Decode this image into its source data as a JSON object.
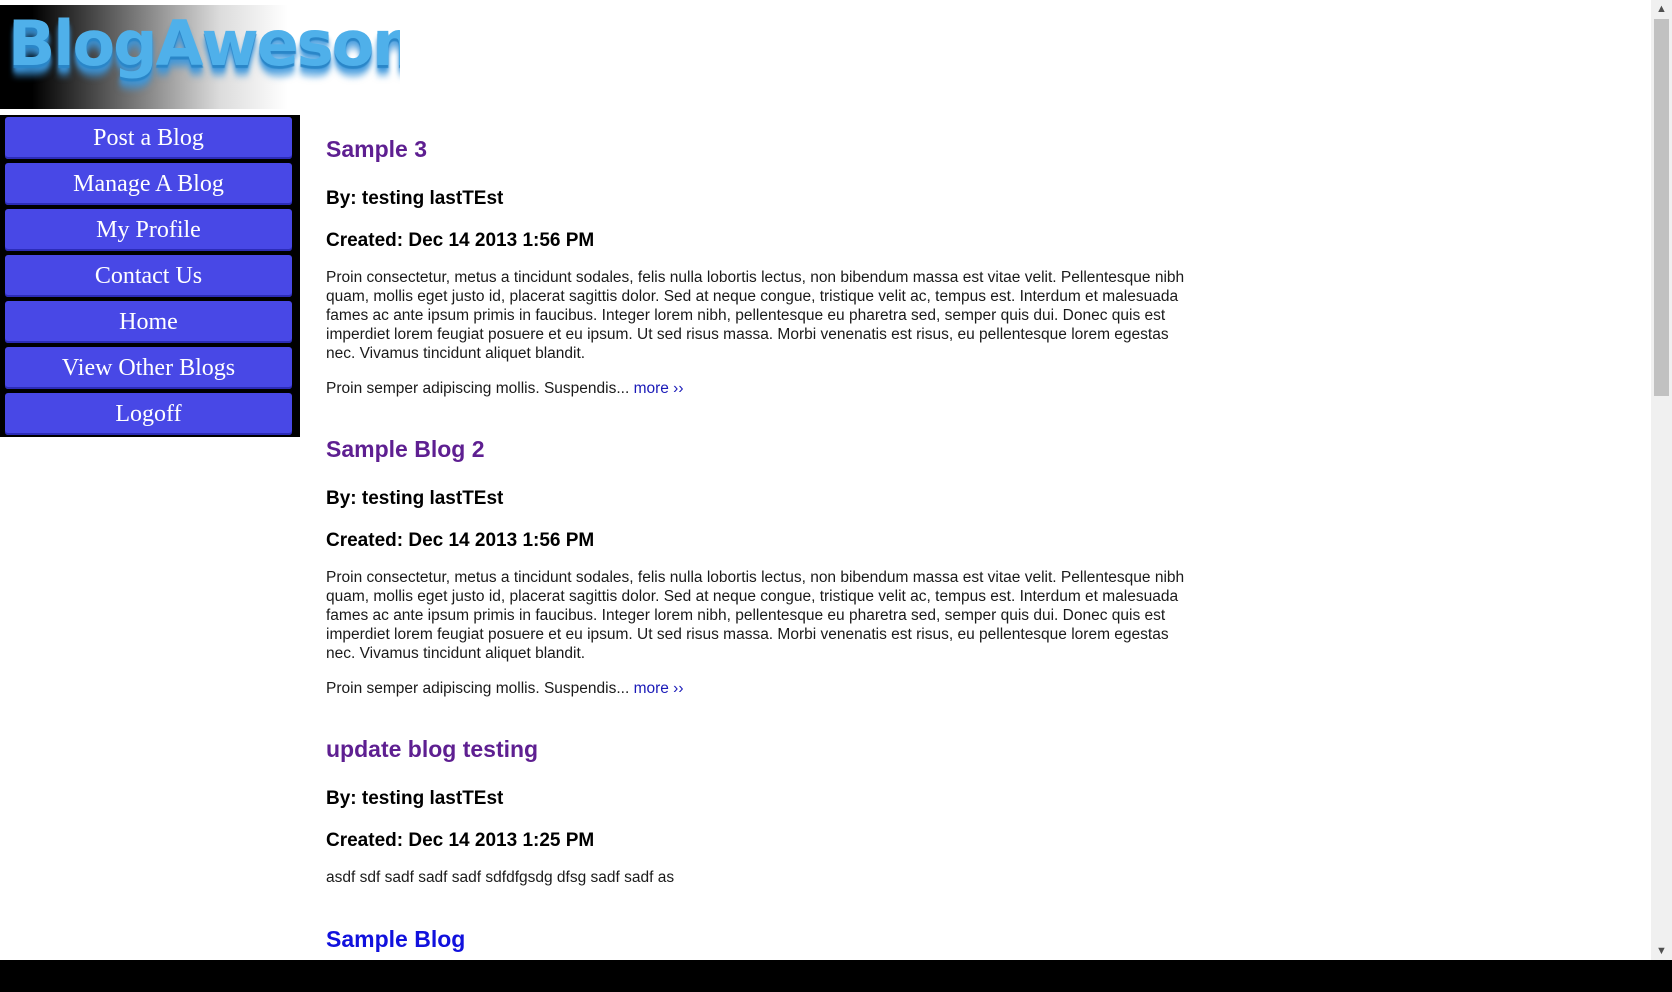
{
  "logo": {
    "text": "BlogAwesome!"
  },
  "nav": {
    "items": [
      {
        "label": "Post a Blog"
      },
      {
        "label": "Manage A Blog"
      },
      {
        "label": "My Profile"
      },
      {
        "label": "Contact Us"
      },
      {
        "label": "Home"
      },
      {
        "label": "View Other Blogs"
      },
      {
        "label": "Logoff"
      }
    ]
  },
  "posts": [
    {
      "title": "Sample 3",
      "author": "By: testing lastTEst",
      "created": "Created: Dec 14 2013 1:56 PM",
      "body": "Proin consectetur, metus a tincidunt sodales, felis nulla lobortis lectus, non bibendum massa est vitae velit. Pellentesque nibh quam, mollis eget justo id, placerat sagittis dolor. Sed at neque congue, tristique velit ac, tempus est. Interdum et malesuada fames ac ante ipsum primis in faucibus. Integer lorem nibh, pellentesque eu pharetra sed, semper quis dui. Donec quis est imperdiet lorem feugiat posuere et eu ipsum. Ut sed risus massa. Morbi venenatis est risus, eu pellentesque lorem egestas nec. Vivamus tincidunt aliquet blandit.",
      "excerpt": "Proin semper adipiscing mollis. Suspendis... ",
      "more_label": "more ››"
    },
    {
      "title": "Sample Blog 2",
      "author": "By: testing lastTEst",
      "created": "Created: Dec 14 2013 1:56 PM",
      "body": "Proin consectetur, metus a tincidunt sodales, felis nulla lobortis lectus, non bibendum massa est vitae velit. Pellentesque nibh quam, mollis eget justo id, placerat sagittis dolor. Sed at neque congue, tristique velit ac, tempus est. Interdum et malesuada fames ac ante ipsum primis in faucibus. Integer lorem nibh, pellentesque eu pharetra sed, semper quis dui. Donec quis est imperdiet lorem feugiat posuere et eu ipsum. Ut sed risus massa. Morbi venenatis est risus, eu pellentesque lorem egestas nec. Vivamus tincidunt aliquet blandit.",
      "excerpt": "Proin semper adipiscing mollis. Suspendis... ",
      "more_label": "more ››"
    },
    {
      "title": "update blog testing",
      "author": "By: testing lastTEst",
      "created": "Created: Dec 14 2013 1:25 PM",
      "body": "asdf sdf sadf sadf sadf sdfdfgsdg dfsg sadf sadf as"
    },
    {
      "title": "Sample Blog"
    }
  ],
  "colors": {
    "nav_button": "#4848e6",
    "visited_title": "#5e1f91",
    "unvisited_title": "#1111dd",
    "logo_text": "#4fb0ea"
  },
  "icons": {
    "scroll_up": "chevron-up-icon",
    "scroll_down": "chevron-down-icon"
  }
}
